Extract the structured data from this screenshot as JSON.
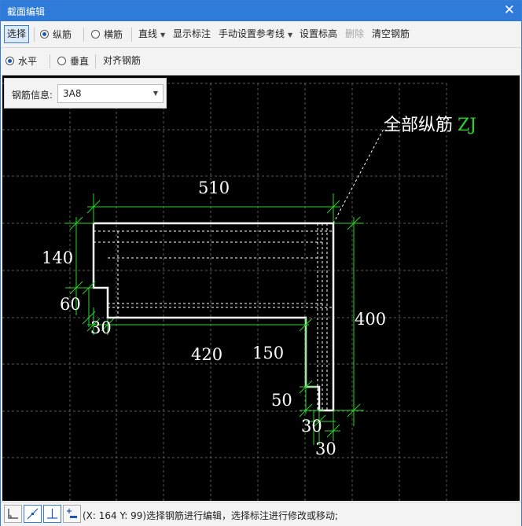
{
  "window": {
    "title": "截面编辑",
    "close_glyph": "✕"
  },
  "toolbar1": {
    "select": "选择",
    "longitudinal": "纵筋",
    "transverse": "横筋",
    "line": "直线",
    "show_dim": "显示标注",
    "manual_ref": "手动设置参考线",
    "set_elev": "设置标高",
    "delete": "删除",
    "clear": "清空钢筋",
    "selected_mode": "longitudinal"
  },
  "toolbar2": {
    "horizontal": "水平",
    "vertical": "垂直",
    "align": "对齐钢筋",
    "selected_orient": "horizontal"
  },
  "rebar_info": {
    "label": "钢筋信息:",
    "value": "3A8"
  },
  "drawing": {
    "callout": {
      "text": "全部纵筋",
      "code": "ZJ"
    },
    "dims": {
      "top": "510",
      "left_upper": "140",
      "left_step": "60",
      "left_step_w": "30",
      "bottom_inner": "420",
      "inner_drop": "150",
      "right": "400",
      "lower_step": "50",
      "lower_step_w": "30",
      "bottom_w": "30"
    },
    "colors": {
      "shape": "#ffffff",
      "dim": "#2bd62b",
      "grid": "#5a5a5a",
      "code": "#2bd62b"
    }
  },
  "statusbar": {
    "tools": [
      "ortho-icon",
      "free-line-icon",
      "perpendicular-icon",
      "add-dim-icon"
    ],
    "text": "(X: 164 Y: 99)选择钢筋进行编辑，选择标注进行修改或移动;"
  }
}
